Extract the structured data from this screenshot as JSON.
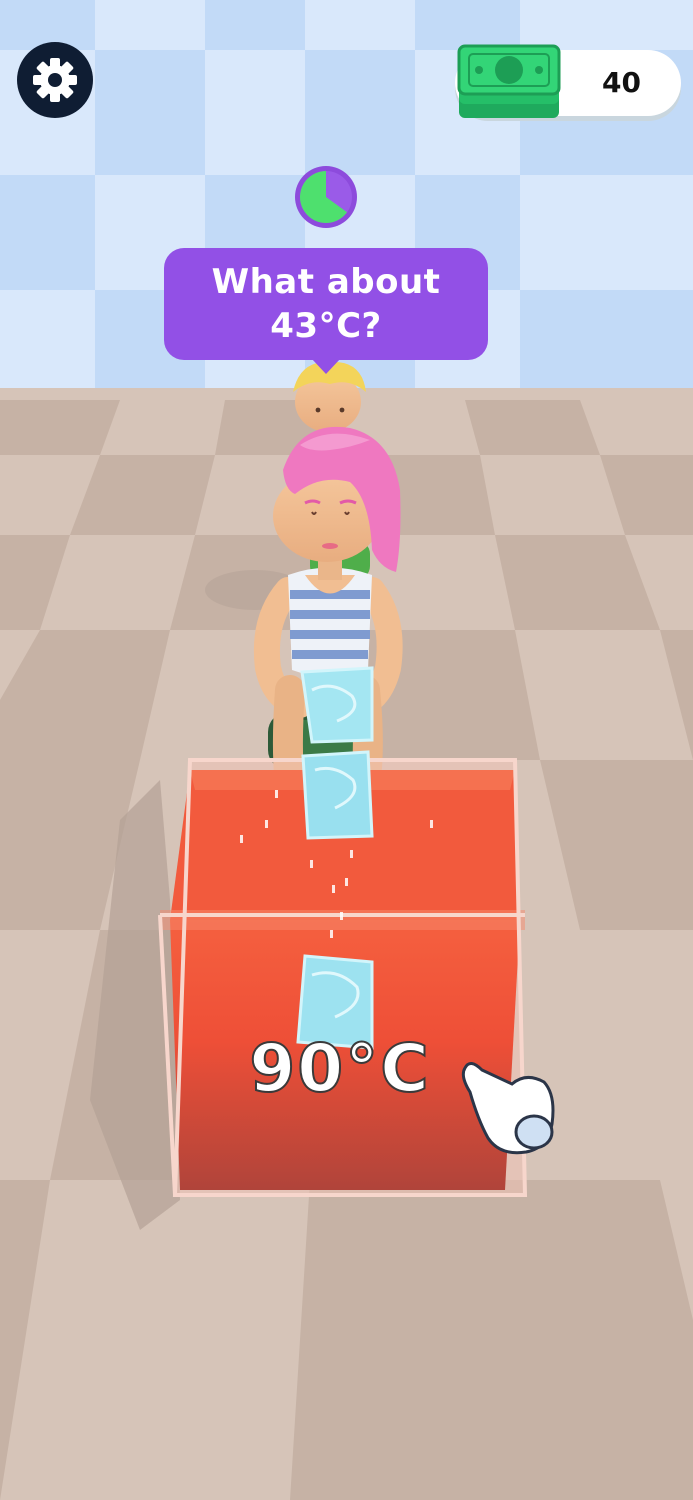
{
  "hud": {
    "settings_icon": "gear-icon",
    "cash_amount": "40",
    "cash_icon": "money-stack-icon"
  },
  "customer": {
    "request_text": "What about 43°C?",
    "timer_progress": 0.35
  },
  "tank": {
    "temperature_label": "90°C"
  },
  "colors": {
    "bubble": "#9250e6",
    "timer_fill": "#4ee06e",
    "water": "#f0543b",
    "ice": "#9fe3f0",
    "floor": "#d2c0b4",
    "wall_tile": "#c5dcf7"
  }
}
